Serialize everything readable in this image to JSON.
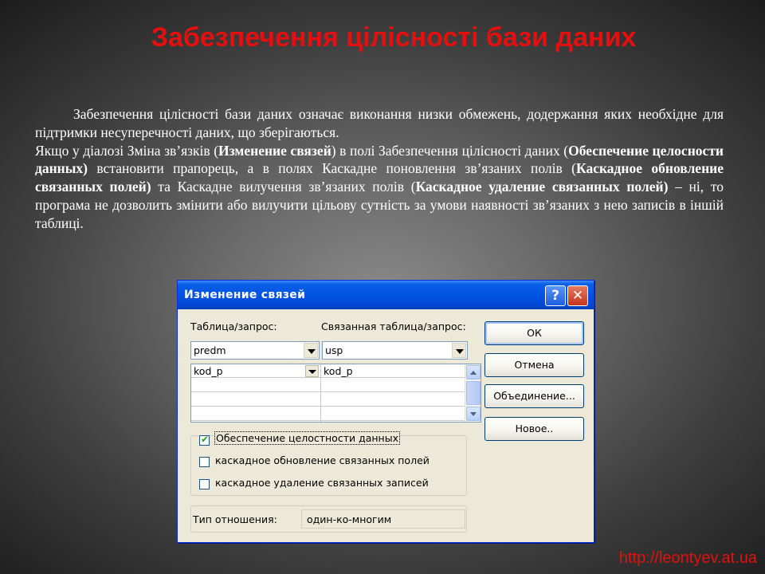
{
  "slide": {
    "title": "Забезпечення цілісності бази даних",
    "paragraph1": "Забезпечення цілісності бази даних означає виконання низки обмежень, додержання яких необхідне для підтримки несуперечності  даних, що зберігаються.",
    "p2": {
      "t1": "Якщо у діалозі Зміна зв’язків (",
      "b1": "Изменение связей",
      "t2": ") в полі Забезпечення цілісності даних (",
      "b2": "Обеспечение целосности данных)",
      "t3": " встановити прапорець, а в полях Каскадне поновлення зв’язаних полів (",
      "b3": "Каскадное обновление связанных полей)",
      "t4": " та Каскадне вилучення зв’язаних полів (",
      "b4": "Каскадное удаление связанных полей)",
      "t5": " – ні, то програма не дозволить змінити або вилучити цільову сутність за умови наявності зв’язаних з нею записів в іншій таблиці."
    },
    "footer_url": "http://leontyev.at.ua"
  },
  "dialog": {
    "title": "Изменение связей",
    "help_glyph": "?",
    "close_glyph": "✕",
    "table_label": "Таблица/запрос:",
    "related_label": "Связанная таблица/запрос:",
    "table_value": "predm",
    "related_value": "usp",
    "grid_rows": [
      {
        "left": "kod_p",
        "right": "kod_p"
      }
    ],
    "checkboxes": [
      {
        "label": "Обеспечение целостности данных",
        "checked": true
      },
      {
        "label": "каскадное обновление связанных полей",
        "checked": false
      },
      {
        "label": "каскадное удаление связанных записей",
        "checked": false
      }
    ],
    "relation_type_label": "Тип отношения:",
    "relation_type_value": "один-ко-многим",
    "buttons": {
      "ok": "ОК",
      "cancel": "Отмена",
      "join": "Объединение...",
      "new": "Новое.."
    }
  }
}
